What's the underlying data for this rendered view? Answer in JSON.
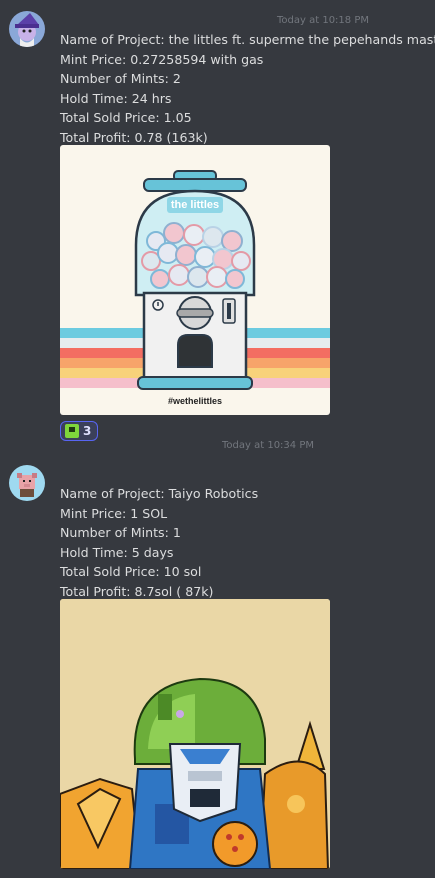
{
  "messages": [
    {
      "timestamp": "Today at 10:18 PM",
      "lines": [
        "Name of Project: the littles ft. superme the pepehands master",
        "Mint Price: 0.27258594 with gas",
        "Number of Mints: 2",
        "Hold Time: 24 hrs",
        "Total Sold Price: 1.05",
        "Total Profit: 0.78 (163k)"
      ],
      "attachment": {
        "brand_text": "the littles",
        "hashtag_text": "#wethelittles"
      },
      "reaction": {
        "emoji_icon": "green-square-emoji-icon",
        "count": "3"
      }
    },
    {
      "timestamp": "Today at 10:34 PM",
      "lines": [
        "Name of Project: Taiyo Robotics",
        "Mint Price: 1 SOL",
        "Number of Mints: 1",
        "Hold Time:  5 days",
        "Total Sold Price:  10 sol",
        "Total Profit: 8.7sol ( 87k)"
      ]
    }
  ],
  "colors": {
    "background": "#36393f",
    "text": "#dcddde",
    "timestamp": "#72767d",
    "reaction_border": "#5865f2"
  }
}
